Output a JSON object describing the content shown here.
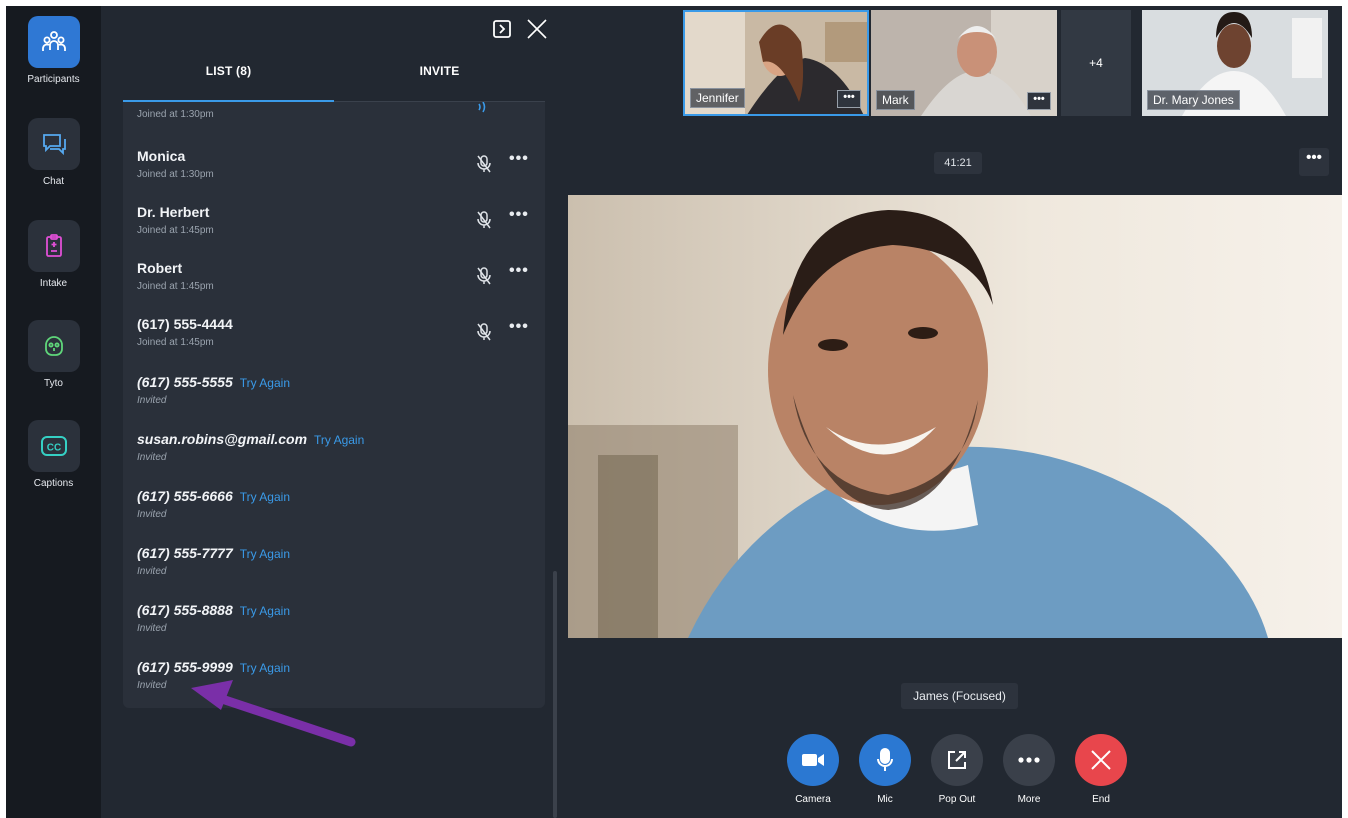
{
  "rail": {
    "items": [
      {
        "label": "Participants",
        "icon": "participants-icon",
        "active": true
      },
      {
        "label": "Chat",
        "icon": "chat-icon"
      },
      {
        "label": "Intake",
        "icon": "clipboard-icon"
      },
      {
        "label": "Tyto",
        "icon": "tyto-icon"
      },
      {
        "label": "Captions",
        "icon": "captions-icon"
      }
    ]
  },
  "panel": {
    "tabs": [
      {
        "label": "LIST (8)"
      },
      {
        "label": "INVITE"
      }
    ],
    "rows": [
      {
        "sub": "Joined at 1:30pm"
      },
      {
        "name": "Monica",
        "sub": "Joined at 1:30pm"
      },
      {
        "name": "Dr. Herbert",
        "sub": "Joined at 1:45pm"
      },
      {
        "name": "Robert",
        "sub": "Joined at 1:45pm"
      },
      {
        "name": "(617) 555-4444",
        "sub": "Joined at 1:45pm"
      },
      {
        "name": "(617) 555-5555",
        "action": "Try Again",
        "sub": "Invited"
      },
      {
        "name": "susan.robins@gmail.com",
        "action": "Try Again",
        "sub": "Invited"
      },
      {
        "name": "(617) 555-6666",
        "action": "Try Again",
        "sub": "Invited"
      },
      {
        "name": "(617) 555-7777",
        "action": "Try Again",
        "sub": "Invited"
      },
      {
        "name": "(617) 555-8888",
        "action": "Try Again",
        "sub": "Invited"
      },
      {
        "name": "(617) 555-9999",
        "action": "Try Again",
        "sub": "Invited"
      }
    ]
  },
  "stage": {
    "thumbnails": [
      {
        "name": "Jennifer"
      },
      {
        "name": "Mark"
      },
      {
        "label": "+4"
      },
      {
        "name": "Dr. Mary Jones"
      }
    ],
    "timer": "41:21",
    "focused_label": "James (Focused)"
  },
  "controls": [
    {
      "label": "Camera",
      "icon": "camera-icon",
      "color": "#2b78d2"
    },
    {
      "label": "Mic",
      "icon": "mic-icon",
      "color": "#2b78d2"
    },
    {
      "label": "Pop Out",
      "icon": "pop-out-icon",
      "color": "#3a404a"
    },
    {
      "label": "More",
      "icon": "more-icon",
      "color": "#3a404a"
    },
    {
      "label": "End",
      "icon": "end-icon",
      "color": "#e8464c"
    }
  ],
  "colors": {
    "accent": "#3a9ae8",
    "end": "#e8464c",
    "annotation": "#7a2fa8"
  }
}
